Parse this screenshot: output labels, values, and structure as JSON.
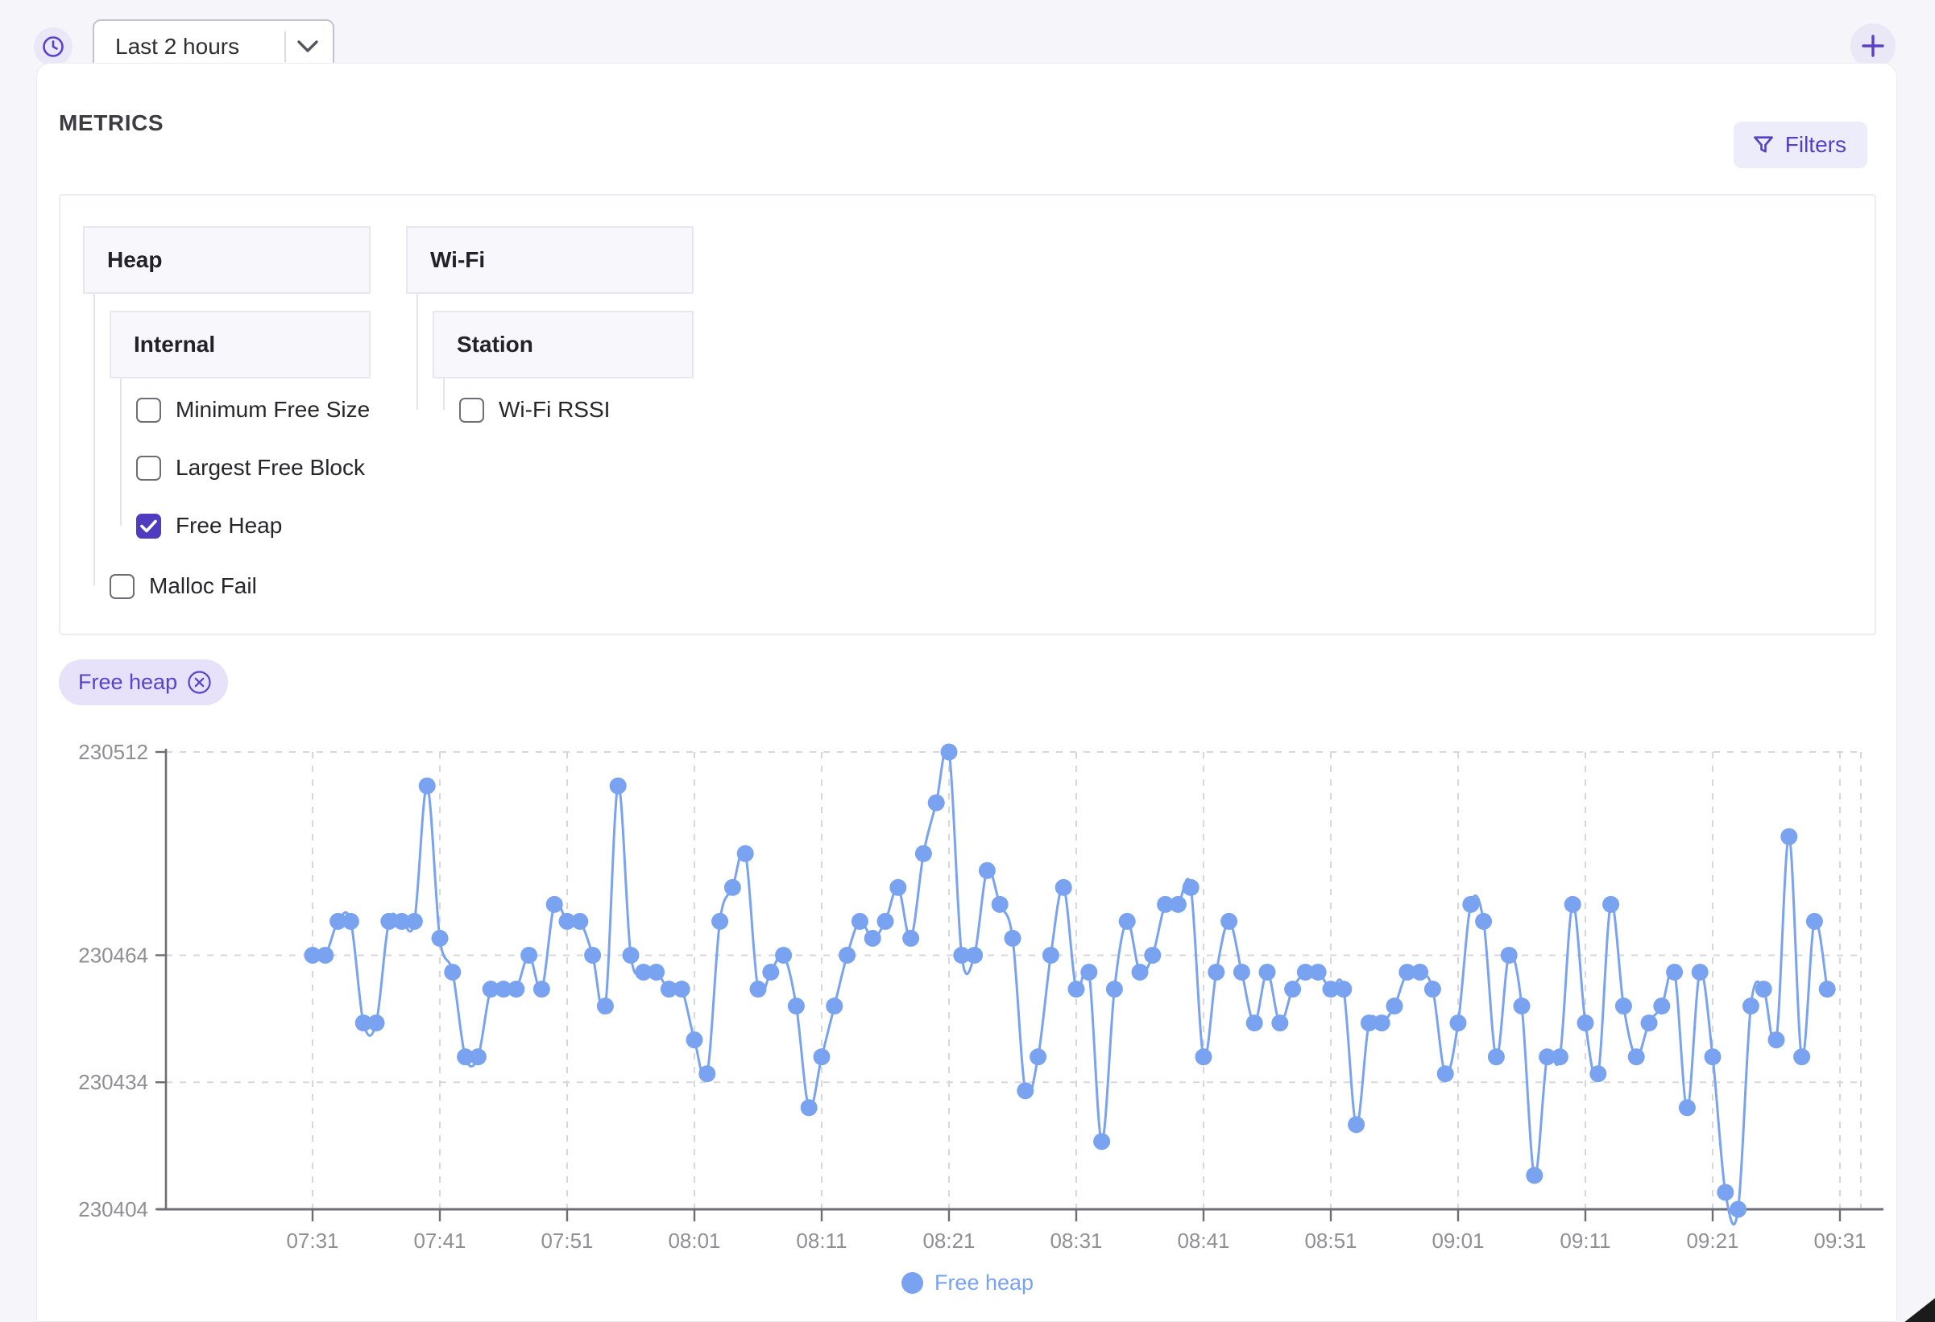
{
  "toolbar": {
    "time_range": "Last 2 hours"
  },
  "panel": {
    "title": "METRICS",
    "filters_label": "Filters"
  },
  "metrics_tree": {
    "groups": [
      {
        "label": "Heap",
        "children": [
          {
            "label": "Internal",
            "children": [
              {
                "label": "Minimum Free Size",
                "checked": false
              },
              {
                "label": "Largest Free Block",
                "checked": false
              },
              {
                "label": "Free Heap",
                "checked": true
              }
            ]
          },
          {
            "label": "Malloc Fail",
            "checked": false
          }
        ]
      },
      {
        "label": "Wi-Fi",
        "children": [
          {
            "label": "Station",
            "children": [
              {
                "label": "Wi-Fi RSSI",
                "checked": false
              }
            ]
          }
        ]
      }
    ]
  },
  "selected_chip": {
    "label": "Free heap"
  },
  "chart_data": {
    "type": "line",
    "title": "",
    "xlabel": "",
    "ylabel": "",
    "grid": "dashed",
    "legend_position": "bottom",
    "ylim": [
      230404,
      230512
    ],
    "yticks": [
      230512,
      230464,
      230434,
      230404
    ],
    "xticks": [
      "07:31",
      "07:41",
      "07:51",
      "08:01",
      "08:11",
      "08:21",
      "08:31",
      "08:41",
      "08:51",
      "09:01",
      "09:11",
      "09:21",
      "09:31"
    ],
    "series": [
      {
        "name": "Free heap",
        "color": "#79a3f0",
        "start_time": "07:31",
        "interval_minutes": 1,
        "values": [
          230464,
          230464,
          230472,
          230472,
          230448,
          230448,
          230472,
          230472,
          230472,
          230504,
          230468,
          230460,
          230440,
          230440,
          230456,
          230456,
          230456,
          230464,
          230456,
          230476,
          230472,
          230472,
          230464,
          230452,
          230504,
          230464,
          230460,
          230460,
          230456,
          230456,
          230444,
          230436,
          230472,
          230480,
          230488,
          230456,
          230460,
          230464,
          230452,
          230428,
          230440,
          230452,
          230464,
          230472,
          230468,
          230472,
          230480,
          230468,
          230488,
          230500,
          230512,
          230464,
          230464,
          230484,
          230476,
          230468,
          230432,
          230440,
          230464,
          230480,
          230456,
          230460,
          230420,
          230456,
          230472,
          230460,
          230464,
          230476,
          230476,
          230480,
          230440,
          230460,
          230472,
          230460,
          230448,
          230460,
          230448,
          230456,
          230460,
          230460,
          230456,
          230456,
          230424,
          230448,
          230448,
          230452,
          230460,
          230460,
          230456,
          230436,
          230448,
          230476,
          230472,
          230440,
          230464,
          230452,
          230412,
          230440,
          230440,
          230476,
          230448,
          230436,
          230476,
          230452,
          230440,
          230448,
          230452,
          230460,
          230428,
          230460,
          230440,
          230408,
          230404,
          230452,
          230456,
          230444,
          230492,
          230440,
          230472,
          230456
        ]
      }
    ]
  },
  "colors": {
    "accent": "#5b3fc9",
    "accent_bg": "#eae8f7",
    "chip_bg": "#e7e2f9",
    "series_blue": "#79a3f0",
    "axis_text": "#8f8f95",
    "grid_line": "#d7d7dd"
  }
}
